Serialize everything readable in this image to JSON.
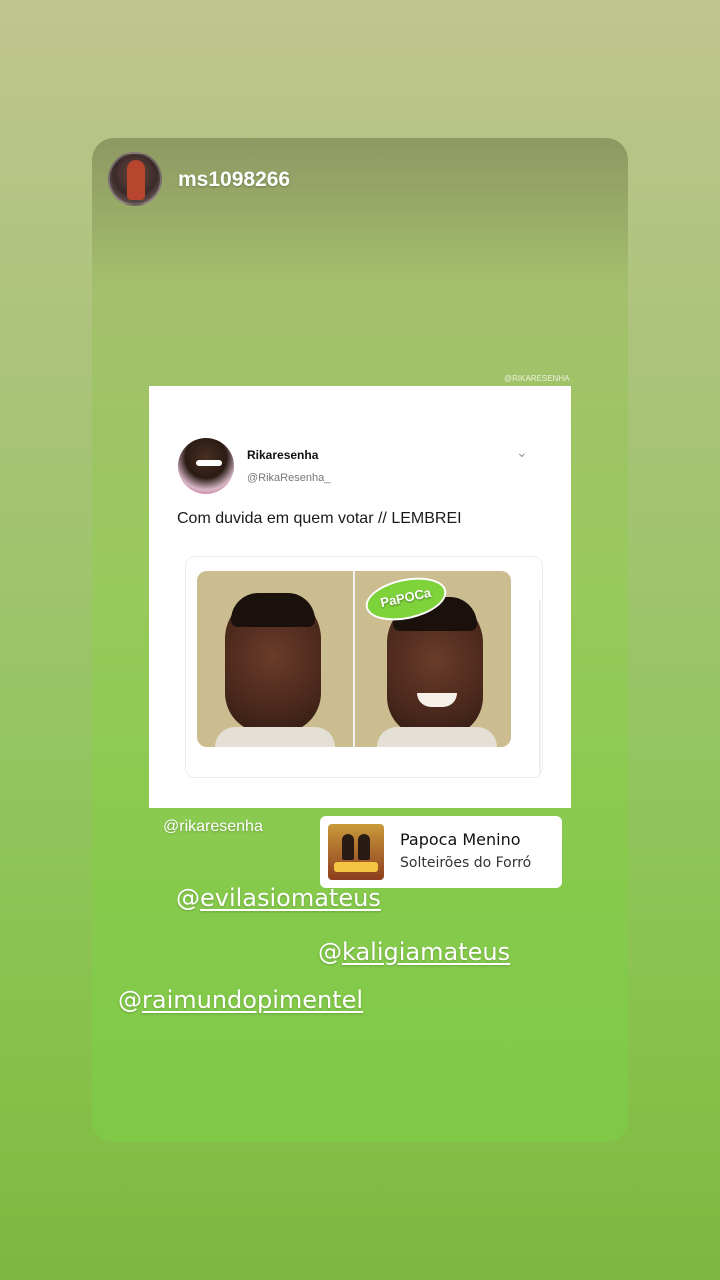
{
  "story": {
    "username": "ms1098266"
  },
  "post": {
    "watermark": "@RIKARESENHA",
    "author_name": "Rikaresenha",
    "author_handle": "@RikaResenha_",
    "caret_icon": "chevron-down-icon",
    "text": "Com duvida em quem votar // LEMBREI",
    "sticker_text": "PaPOCa"
  },
  "credit": "@rikaresenha",
  "music": {
    "title": "Papoca Menino",
    "artist": "Solteirões do Forró"
  },
  "mentions": [
    {
      "at": "@",
      "name": "evilasiomateus"
    },
    {
      "at": "@",
      "name": "kaligiamateus"
    },
    {
      "at": "@",
      "name": "raimundopimentel"
    }
  ]
}
